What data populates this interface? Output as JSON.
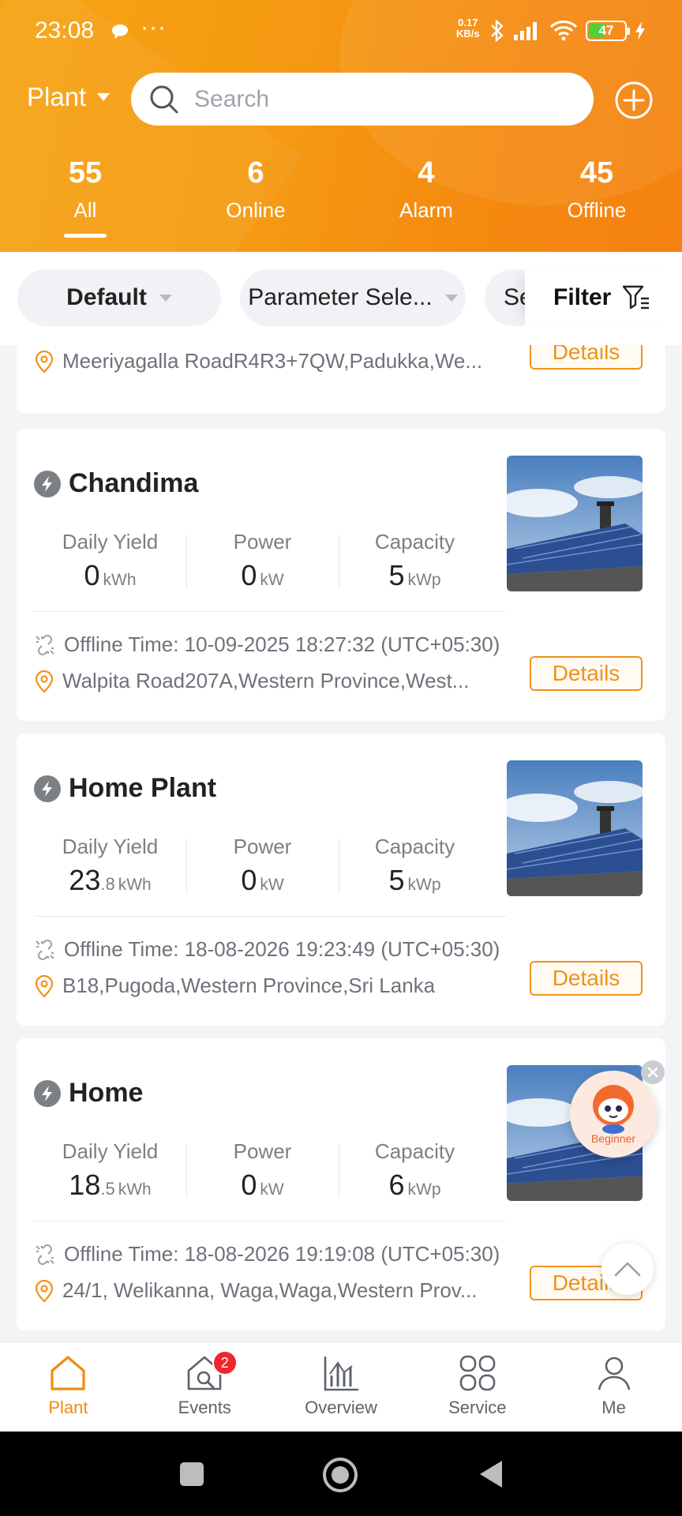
{
  "status_bar": {
    "time": "23:08",
    "dots": "···",
    "net_speed_value": "0.17",
    "net_speed_unit": "KB/s",
    "battery": "47"
  },
  "header": {
    "plant_selector": "Plant",
    "search_placeholder": "Search",
    "stats": [
      {
        "count": "55",
        "label": "All"
      },
      {
        "count": "6",
        "label": "Online"
      },
      {
        "count": "4",
        "label": "Alarm"
      },
      {
        "count": "45",
        "label": "Offline"
      }
    ]
  },
  "filters": {
    "default": "Default",
    "parameter": "Parameter Sele...",
    "third": "Se",
    "filter_label": "Filter"
  },
  "partial_card": {
    "address": "Meeriyagalla RoadR4R3+7QW,Padukka,We...",
    "details": "Details"
  },
  "labels": {
    "daily_yield": "Daily Yield",
    "power": "Power",
    "capacity": "Capacity",
    "details": "Details"
  },
  "plants": [
    {
      "name": "Chandima",
      "yield_int": "0",
      "yield_dec": "",
      "yield_unit": "kWh",
      "power": "0",
      "power_unit": "kW",
      "capacity": "5",
      "capacity_unit": "kWp",
      "offline_time": "Offline Time: 10-09-2025 18:27:32 (UTC+05:30)",
      "address": "Walpita Road207A,Western Province,West..."
    },
    {
      "name": "Home Plant",
      "yield_int": "23",
      "yield_dec": ".8",
      "yield_unit": "kWh",
      "power": "0",
      "power_unit": "kW",
      "capacity": "5",
      "capacity_unit": "kWp",
      "offline_time": "Offline Time: 18-08-2026 19:23:49 (UTC+05:30)",
      "address": "B18,Pugoda,Western Province,Sri Lanka"
    },
    {
      "name": "Home",
      "yield_int": "18",
      "yield_dec": ".5",
      "yield_unit": "kWh",
      "power": "0",
      "power_unit": "kW",
      "capacity": "6",
      "capacity_unit": "kWp",
      "offline_time": "Offline Time: 18-08-2026 19:19:08 (UTC+05:30)",
      "address": "24/1, Welikanna, Waga,Waga,Western Prov..."
    }
  ],
  "floating": {
    "beginner_label": "Beginner"
  },
  "bottom_nav": {
    "tabs": [
      {
        "label": "Plant",
        "icon": "home-icon"
      },
      {
        "label": "Events",
        "icon": "house-wrench-icon",
        "badge": "2"
      },
      {
        "label": "Overview",
        "icon": "bar-chart-icon"
      },
      {
        "label": "Service",
        "icon": "grid-icon"
      },
      {
        "label": "Me",
        "icon": "user-icon"
      }
    ]
  },
  "colors": {
    "accent": "#f08a12",
    "header_start": "#f6a415",
    "header_end": "#f5820f",
    "badge": "#f0262d"
  }
}
